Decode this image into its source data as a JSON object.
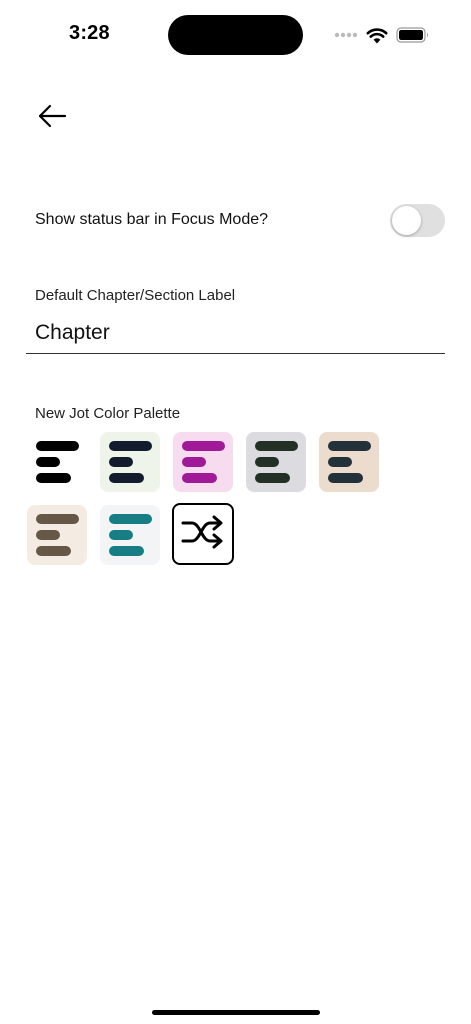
{
  "status_bar": {
    "time": "3:28",
    "icons": [
      "signal-icon",
      "wifi-icon",
      "battery-icon"
    ]
  },
  "header": {
    "back_icon": "arrow-left-icon"
  },
  "settings": {
    "focus_status_bar": {
      "label": "Show status bar in Focus Mode?",
      "enabled": false
    },
    "chapter_label": {
      "label": "Default Chapter/Section Label",
      "value": "Chapter"
    },
    "palette": {
      "label": "New Jot Color Palette",
      "swatches": [
        {
          "background": "#ffffff",
          "bar_color": "#000000"
        },
        {
          "background": "#eef4ea",
          "bar_color": "#131c2e"
        },
        {
          "background": "#f6dcee",
          "bar_color": "#a01a98"
        },
        {
          "background": "#dcdce0",
          "bar_color": "#223026"
        },
        {
          "background": "#ecdccd",
          "bar_color": "#22313a"
        },
        {
          "background": "#f4ece2",
          "bar_color": "#665747"
        },
        {
          "background": "#f3f4f5",
          "bar_color": "#177e86"
        }
      ],
      "shuffle_icon": "shuffle-icon"
    }
  }
}
